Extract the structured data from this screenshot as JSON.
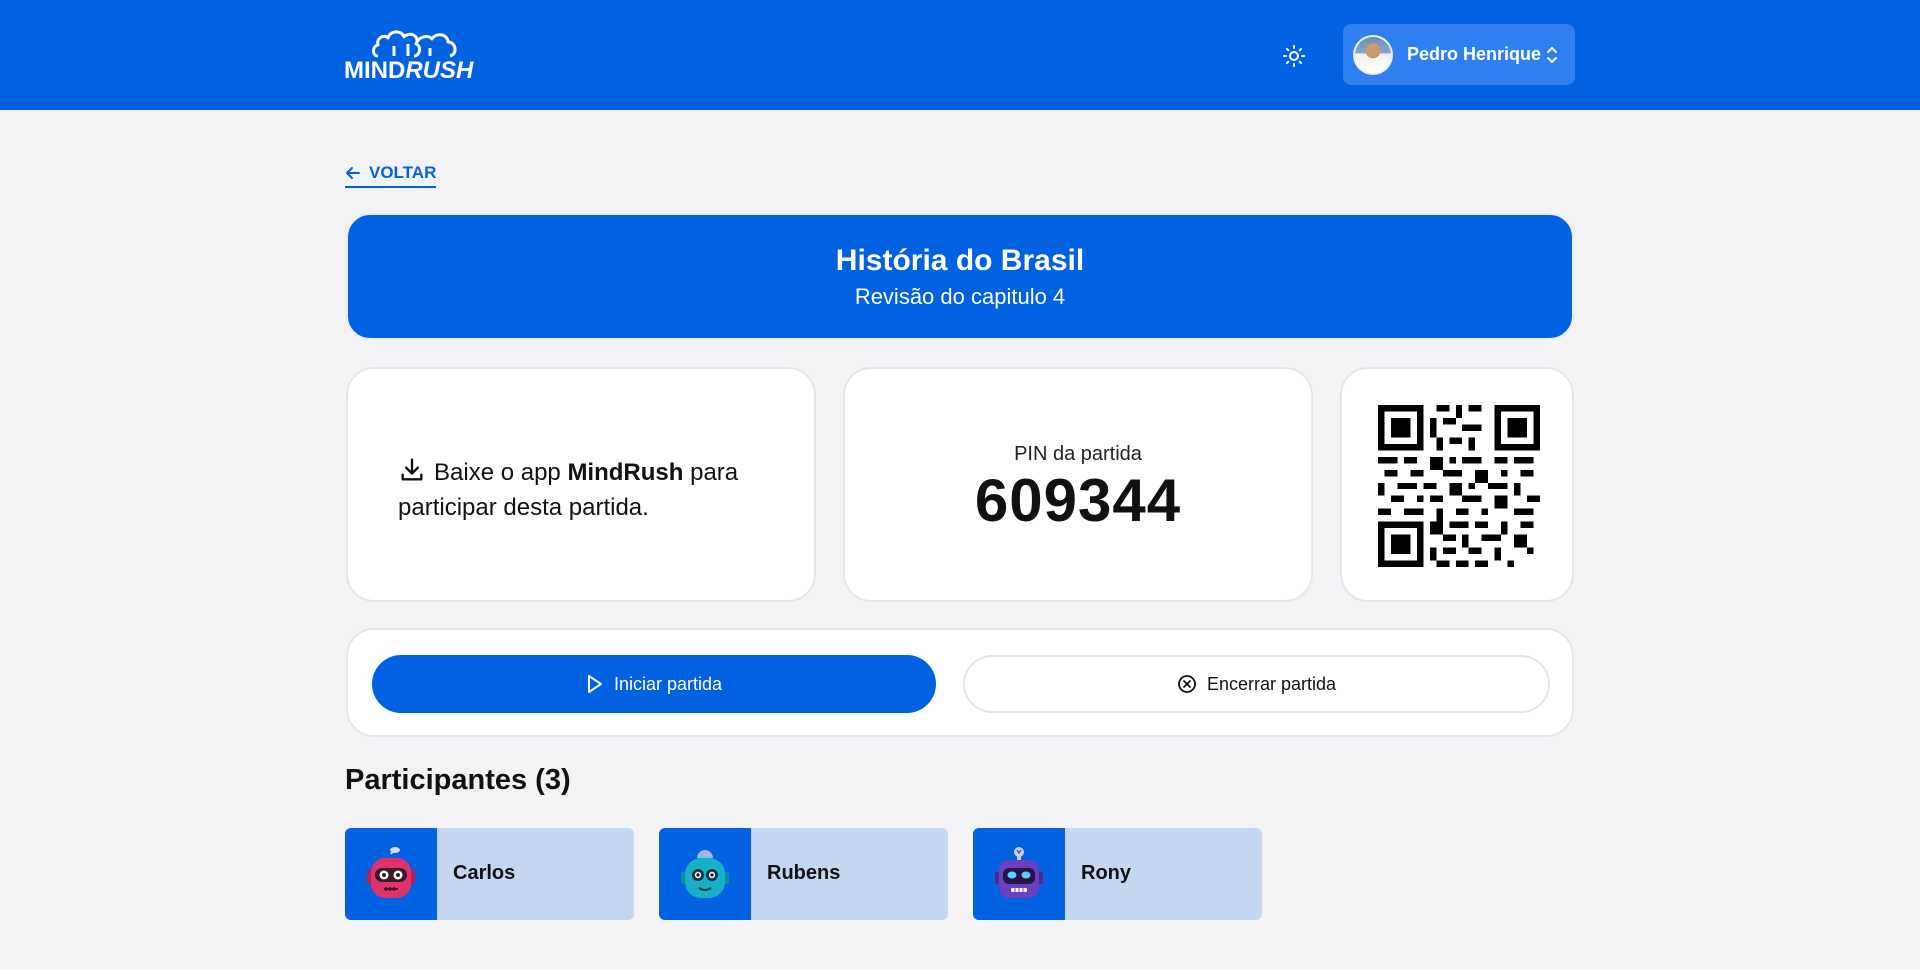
{
  "header": {
    "logo_text_part1": "MIND",
    "logo_text_part2": "RUSH",
    "user_name": "Pedro Henrique",
    "theme_icon": "sun-icon",
    "menu_icon": "chevron-up-down-icon"
  },
  "back_link": {
    "label": "VOLTAR",
    "icon": "arrow-left-icon"
  },
  "quiz": {
    "title": "História do Brasil",
    "subtitle": "Revisão do capitulo 4"
  },
  "download": {
    "icon": "download-icon",
    "prefix": "Baixe o app ",
    "app_name": "MindRush",
    "suffix": " para participar desta partida."
  },
  "pin": {
    "label": "PIN da partida",
    "value": "609344"
  },
  "actions": {
    "start_label": "Iniciar partida",
    "start_icon": "play-icon",
    "end_label": "Encerrar partida",
    "end_icon": "close-circle-icon"
  },
  "participants": {
    "title": "Participantes (3)",
    "list": [
      {
        "name": "Carlos",
        "robot_color": "#e0336b"
      },
      {
        "name": "Rubens",
        "robot_color": "#17b0c8"
      },
      {
        "name": "Rony",
        "robot_color": "#6a3fc0"
      }
    ]
  },
  "colors": {
    "brand": "#0062e0",
    "background": "#f3f3f5",
    "participant_bg": "#c5d6f1"
  }
}
